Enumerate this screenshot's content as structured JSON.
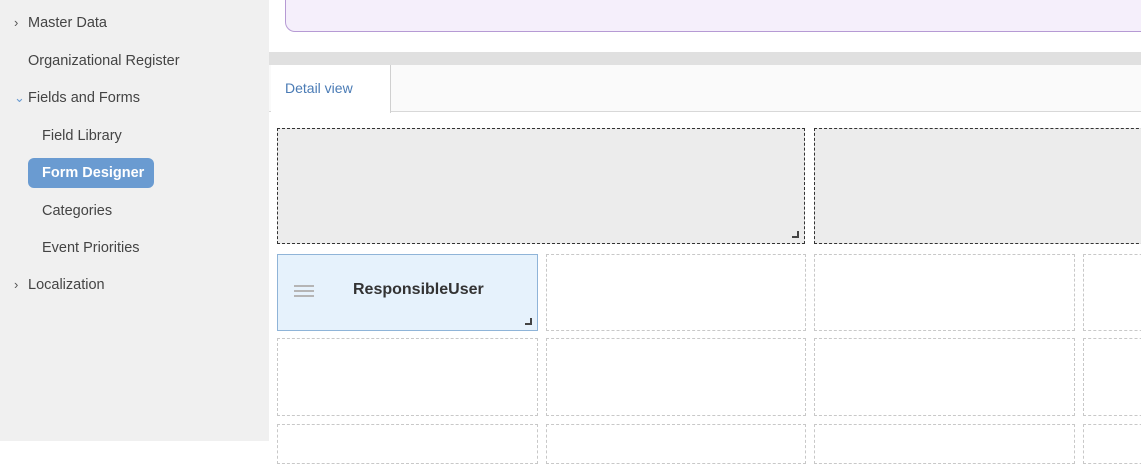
{
  "sidebar": {
    "items": [
      {
        "label": "Master Data",
        "expander": "›"
      },
      {
        "label": "Organizational Register"
      },
      {
        "label": "Fields and Forms",
        "expander": "⌄"
      },
      {
        "label": "Field Library"
      },
      {
        "label": "Form Designer",
        "active": true
      },
      {
        "label": "Categories"
      },
      {
        "label": "Event Priorities"
      },
      {
        "label": "Localization",
        "expander": "›"
      }
    ],
    "active_color": "#6a9bd1"
  },
  "main": {
    "tabs": [
      {
        "label": "Detail view",
        "active": true
      }
    ],
    "form_fields": [
      {
        "label": "ResponsibleUser"
      }
    ]
  }
}
